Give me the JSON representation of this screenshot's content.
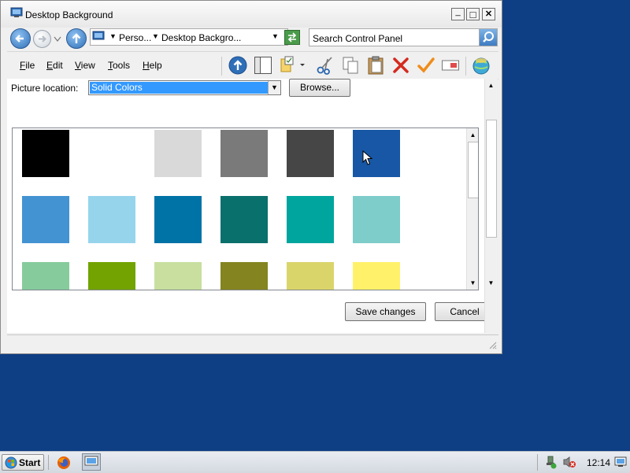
{
  "window": {
    "title": "Desktop Background",
    "controls": {
      "minimize": "_",
      "maximize": "□",
      "close": "✕"
    }
  },
  "address": {
    "crumbs": [
      "Perso...",
      "Desktop Backgro..."
    ],
    "search_placeholder": "Search Control Panel"
  },
  "menu": {
    "items": [
      {
        "key": "F",
        "rest": "ile"
      },
      {
        "key": "E",
        "rest": "dit"
      },
      {
        "key": "V",
        "rest": "iew"
      },
      {
        "key": "T",
        "rest": "ools"
      },
      {
        "key": "H",
        "rest": "elp"
      }
    ]
  },
  "content": {
    "picture_location_label": "Picture location:",
    "picture_location_value": "Solid Colors",
    "browse_label": "Browse...",
    "save_label": "Save changes",
    "cancel_label": "Cancel"
  },
  "swatches": {
    "row1": [
      "#000000",
      "#ffffff",
      "#d9d9d9",
      "#7a7a7a",
      "#464646",
      "#1757a5"
    ],
    "row2": [
      "#4393d2",
      "#96d4ec",
      "#0073a6",
      "#0a706c",
      "#00a59d",
      "#7ecdca"
    ],
    "row3": [
      "#86cb9c",
      "#72a300",
      "#c8df9f",
      "#848420",
      "#dad56b",
      "#fff16a"
    ]
  },
  "taskbar": {
    "start_label": "Start",
    "clock": "12:14"
  },
  "colors": {
    "desktop": "#0e3f84",
    "selection": "#3399ff"
  }
}
